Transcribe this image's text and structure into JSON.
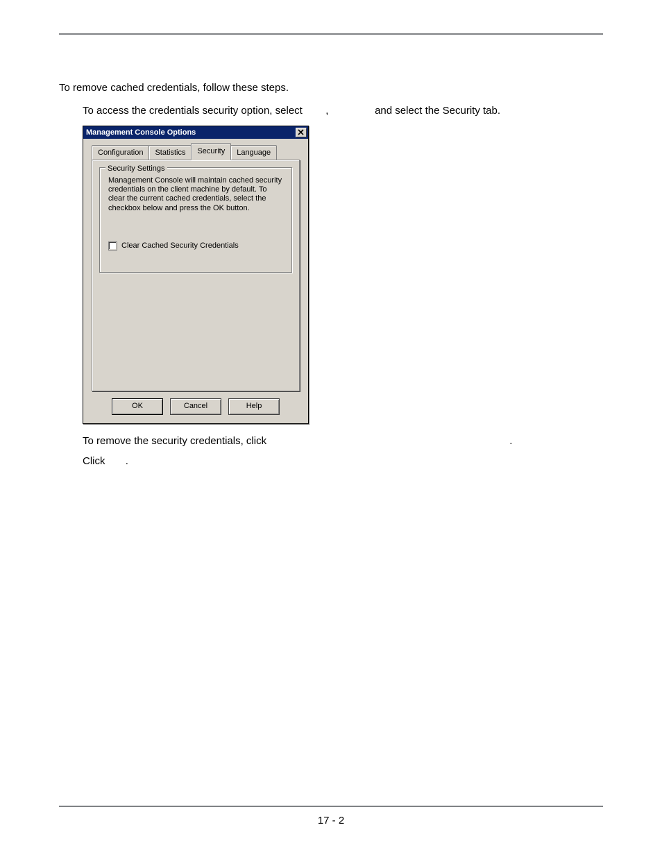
{
  "doc": {
    "intro": "To remove cached credentials, follow these steps.",
    "step1_a": "To access the credentials security option, select ",
    "step1_comma": ",",
    "step1_b": " and select the Security tab.",
    "step2": "To remove the security credentials, click ",
    "step2_end": ".",
    "step3": "Click ",
    "step3_end": ".",
    "pagenum": "17 - 2"
  },
  "dialog": {
    "title": "Management Console Options",
    "tabs": {
      "config": "Configuration",
      "stats": "Statistics",
      "security": "Security",
      "language": "Language"
    },
    "group": {
      "legend": "Security Settings",
      "text": "Management Console will maintain cached security credentials on the client machine by default.  To clear the current cached credentials, select the checkbox below and press the OK button.",
      "checkbox_label": "Clear Cached Security Credentials"
    },
    "buttons": {
      "ok": "OK",
      "cancel": "Cancel",
      "help": "Help"
    }
  }
}
